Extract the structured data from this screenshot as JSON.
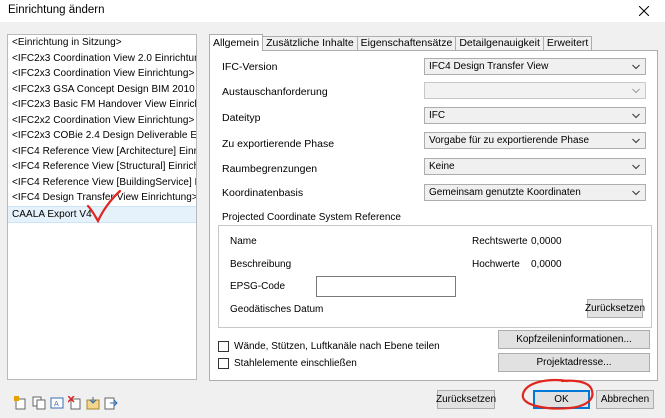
{
  "window": {
    "title": "Einrichtung ändern"
  },
  "setups": [
    "<Einrichtung in Sitzung>",
    "<IFC2x3 Coordination View 2.0 Einrichtung>",
    "<IFC2x3 Coordination View Einrichtung>",
    "<IFC2x3 GSA Concept Design BIM 2010 Einric",
    "<IFC2x3 Basic FM Handover View Einrichtung",
    "<IFC2x2 Coordination View Einrichtung>",
    "<IFC2x3 COBie 2.4 Design Deliverable Einricht",
    "<IFC4 Reference View [Architecture] Einrichtur",
    "<IFC4 Reference View [Structural] Einrichtung:",
    "<IFC4 Reference View [BuildingService] Einricht",
    "<IFC4 Design Transfer View Einrichtung>",
    "CAALA Export V4"
  ],
  "selected_setup": "CAALA Export V4",
  "tabs": [
    "Allgemein",
    "Zusätzliche Inhalte",
    "Eigenschaftensätze",
    "Detailgenauigkeit",
    "Erweitert"
  ],
  "active_tab": "Allgemein",
  "general": {
    "ifc_version": {
      "label": "IFC-Version",
      "value": "IFC4 Design Transfer View"
    },
    "exchange_requirement": {
      "label": "Austauschanforderung",
      "value": ""
    },
    "file_type": {
      "label": "Dateityp",
      "value": "IFC"
    },
    "phase": {
      "label": "Zu exportierende Phase",
      "value": "Vorgabe für zu exportierende Phase"
    },
    "space_boundaries": {
      "label": "Raumbegrenzungen",
      "value": "Keine"
    },
    "coordinate_base": {
      "label": "Koordinatenbasis",
      "value": "Gemeinsam genutzte Koordinaten"
    }
  },
  "pcs": {
    "title": "Projected Coordinate System Reference",
    "name_label": "Name",
    "description_label": "Beschreibung",
    "epsg_label": "EPSG-Code",
    "epsg_value": "",
    "datum_label": "Geodätisches Datum",
    "easting_label": "Rechtswerte",
    "easting_value": "0,0000",
    "northing_label": "Hochwerte",
    "northing_value": "0,0000",
    "reset_label": "Zurücksetzen"
  },
  "options": {
    "split_label": "Wände, Stützen, Luftkanäle nach Ebene teilen",
    "split_checked": false,
    "steel_label": "Stahlelemente einschließen",
    "steel_checked": false
  },
  "buttons": {
    "header_info": "Kopfzeileninformationen...",
    "project_address": "Projektadresse...",
    "reset": "Zurücksetzen",
    "ok": "OK",
    "cancel": "Abbrechen"
  },
  "annotation_color": "#e0261f"
}
